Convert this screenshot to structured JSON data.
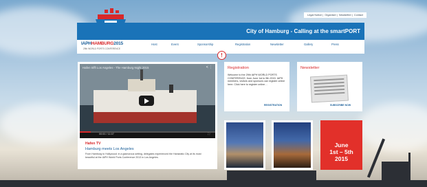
{
  "top_links": [
    "Legal Notice",
    "Organiser",
    "Newsletter",
    "Contact"
  ],
  "tagline": "City of Hamburg - Calling at the smartPORT",
  "logo": {
    "prefix": "IAPH",
    "brand": "HAMBURG",
    "year": "2015",
    "subtitle": "29th WORLD PORTS CONFERENCE"
  },
  "nav": [
    "Host",
    "Event",
    "Sponsorship",
    "Registration",
    "Newsletter",
    "Gallery",
    "Press"
  ],
  "video": {
    "title": "Hafen trifft Los Angeles - The Hamburg Night 2015",
    "time": "00:00 / 11:07",
    "progress": 0.08,
    "caption_kicker": "Hafen TV",
    "caption_title": "Hamburg meets Los Angeles",
    "caption_text": "From Hamburg to Hollywood: in a glamorous setting, delegates experienced the Hanseatic City at its most beautiful at the IAPH World Ports Conference 2013 in Los Angeles."
  },
  "registration": {
    "heading": "Registration",
    "text": "Welcome to the 29th IAPH WORLD PORTS CONFERENCE, from June 1st to 5th 2015. IAPH members, visitors and sponsors can register online here. Click here to register online…",
    "link": "REGISTRATION"
  },
  "newsletter": {
    "heading": "Newsletter",
    "link": "SUBSCRIBE NOW"
  },
  "dates": {
    "line1": "June",
    "line2": "1st – 5th",
    "line3": "2015"
  },
  "colors": {
    "brand_blue": "#1a73b8",
    "accent_red": "#d8282a"
  }
}
